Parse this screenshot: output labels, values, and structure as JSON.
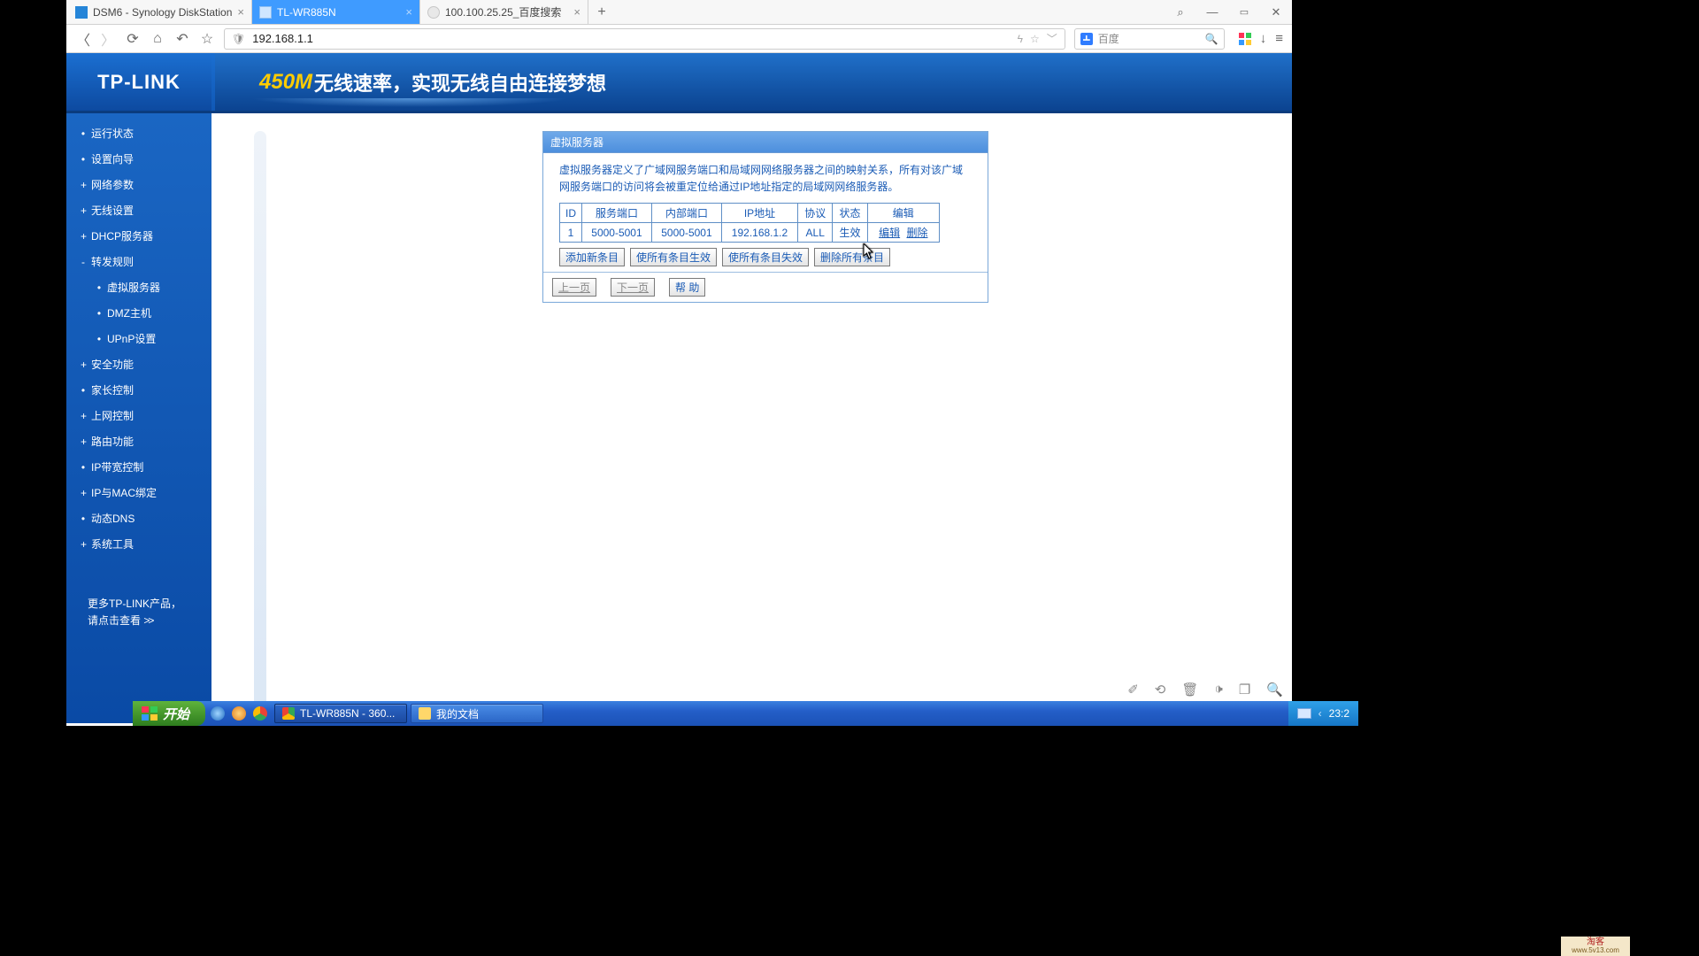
{
  "browser": {
    "tabs": [
      {
        "title": "DSM6 - Synology DiskStation",
        "icon_bg": "#2585d8"
      },
      {
        "title": "TL-WR885N",
        "icon_bg": "#ffffff"
      },
      {
        "title": "100.100.25.25_百度搜索",
        "icon_bg": "#e8e8e8"
      }
    ],
    "url": "192.168.1.1",
    "search_label": "百度"
  },
  "header": {
    "logo": "TP-LINK",
    "banner_accent": "450M",
    "banner_rest": "无线速率，实现无线自由连接梦想"
  },
  "sidebar": {
    "items": [
      {
        "label": "运行状态",
        "bullet": "•"
      },
      {
        "label": "设置向导",
        "bullet": "•"
      },
      {
        "label": "网络参数",
        "bullet": "+"
      },
      {
        "label": "无线设置",
        "bullet": "+"
      },
      {
        "label": "DHCP服务器",
        "bullet": "+"
      },
      {
        "label": "转发规则",
        "bullet": "-"
      },
      {
        "label": "虚拟服务器",
        "bullet": "•",
        "sub": true
      },
      {
        "label": "DMZ主机",
        "bullet": "•",
        "sub": true
      },
      {
        "label": "UPnP设置",
        "bullet": "•",
        "sub": true
      },
      {
        "label": "安全功能",
        "bullet": "+"
      },
      {
        "label": "家长控制",
        "bullet": "•"
      },
      {
        "label": "上网控制",
        "bullet": "+"
      },
      {
        "label": "路由功能",
        "bullet": "+"
      },
      {
        "label": "IP带宽控制",
        "bullet": "•"
      },
      {
        "label": "IP与MAC绑定",
        "bullet": "+"
      },
      {
        "label": "动态DNS",
        "bullet": "•"
      },
      {
        "label": "系统工具",
        "bullet": "+"
      }
    ],
    "promo_line1": "更多TP-LINK产品，",
    "promo_line2": "请点击查看 "
  },
  "panel": {
    "title": "虚拟服务器",
    "desc": "虚拟服务器定义了广域网服务端口和局域网网络服务器之间的映射关系，所有对该广域网服务端口的访问将会被重定位给通过IP地址指定的局域网网络服务器。",
    "columns": [
      "ID",
      "服务端口",
      "内部端口",
      "IP地址",
      "协议",
      "状态",
      "编辑"
    ],
    "rows": [
      {
        "id": "1",
        "svc": "5000-5001",
        "inner": "5000-5001",
        "ip": "192.168.1.2",
        "proto": "ALL",
        "state": "生效",
        "edit": "编辑",
        "del": "删除"
      }
    ],
    "buttons": [
      "添加新条目",
      "使所有条目生效",
      "使所有条目失效",
      "删除所有条目"
    ],
    "pager_prev": "上一页",
    "pager_next": "下一页",
    "pager_help": "帮 助"
  },
  "taskbar": {
    "start": "开始",
    "items": [
      {
        "label": "TL-WR885N - 360...",
        "active": true
      },
      {
        "label": "我的文档",
        "active": false
      }
    ],
    "time": "23:2"
  },
  "watermark": {
    "l1": "淘客",
    "l2": "www.5v13.com"
  }
}
